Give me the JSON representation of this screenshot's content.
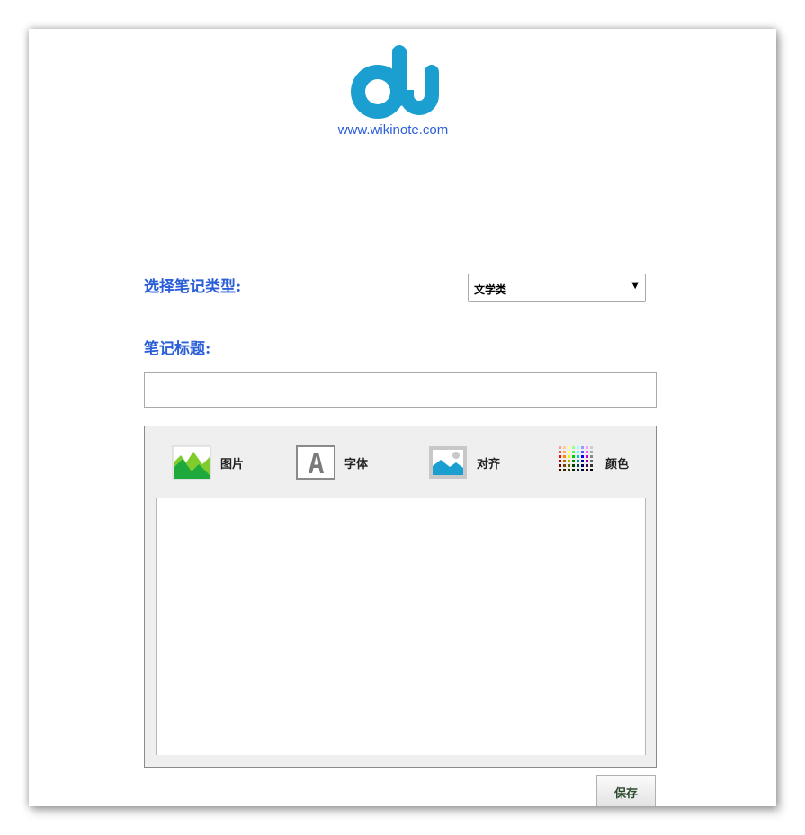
{
  "logo": {
    "icon": "du-logo-icon",
    "url_text": "www.wikinote.com",
    "brand_color": "#1a9fd0"
  },
  "form": {
    "type_label": "选择笔记类型:",
    "type_select": {
      "selected": "文学类",
      "arrow": "▼"
    },
    "title_label": "笔记标题:",
    "title_input": {
      "value": ""
    }
  },
  "toolbar": {
    "items": [
      {
        "label": "图片",
        "icon": "image-icon"
      },
      {
        "label": "字体",
        "icon": "font-icon"
      },
      {
        "label": "对齐",
        "icon": "align-picture-icon"
      },
      {
        "label": "颜色",
        "icon": "color-palette-icon"
      }
    ]
  },
  "actions": {
    "save_label": "保存"
  },
  "colors": {
    "label_blue": "#2b5fd8",
    "accent": "#1a9fd0"
  }
}
